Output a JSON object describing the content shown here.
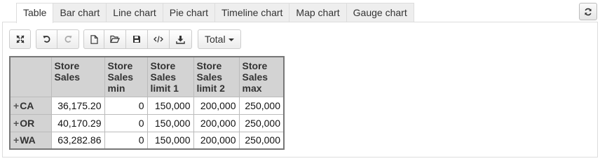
{
  "tabs": [
    "Table",
    "Bar chart",
    "Line chart",
    "Pie chart",
    "Timeline chart",
    "Map chart",
    "Gauge chart"
  ],
  "active_tab": "Table",
  "toolbar": {
    "fullscreen_icon": "expand-icon",
    "undo_icon": "undo-icon",
    "redo_icon": "redo-icon",
    "new_icon": "file-icon",
    "open_icon": "folder-open-icon",
    "save_icon": "floppy-disk-icon",
    "code_icon": "code-icon",
    "export_icon": "download-icon",
    "total_label": "Total"
  },
  "refresh_icon": "refresh-icon",
  "table": {
    "columns": [
      [
        "Store",
        "Sales"
      ],
      [
        "Store",
        "Sales",
        "min"
      ],
      [
        "Store",
        "Sales",
        "limit 1"
      ],
      [
        "Store",
        "Sales",
        "limit 2"
      ],
      [
        "Store",
        "Sales",
        "max"
      ]
    ],
    "rows": [
      {
        "label": "CA",
        "values": [
          "36,175.20",
          "0",
          "150,000",
          "200,000",
          "250,000"
        ]
      },
      {
        "label": "OR",
        "values": [
          "40,170.29",
          "0",
          "150,000",
          "200,000",
          "250,000"
        ]
      },
      {
        "label": "WA",
        "values": [
          "63,282.86",
          "0",
          "150,000",
          "200,000",
          "250,000"
        ]
      }
    ],
    "expand_glyph": "+"
  }
}
